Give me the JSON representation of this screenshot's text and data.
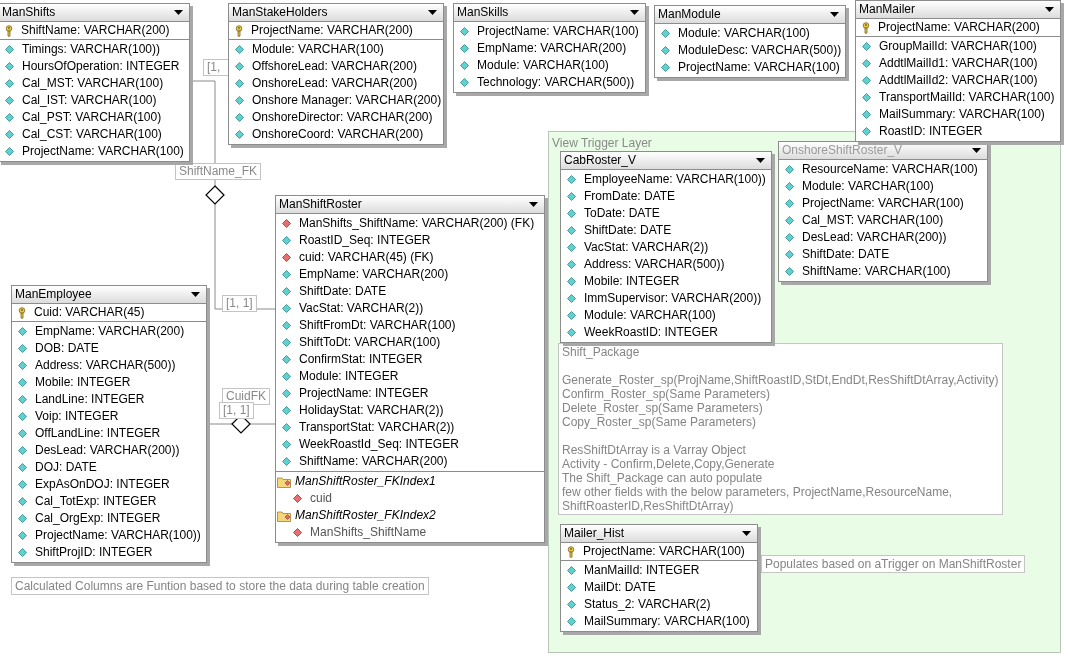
{
  "tables": [
    {
      "name": "ManShifts",
      "dimmed": false,
      "columns": [
        {
          "name": "ShiftName: VARCHAR(200)",
          "kind": "key"
        },
        {
          "name": "Timings: VARCHAR(100))",
          "kind": "attribute"
        },
        {
          "name": "HoursOfOperation: INTEGER",
          "kind": "attribute"
        },
        {
          "name": "Cal_MST: VARCHAR(100)",
          "kind": "attribute"
        },
        {
          "name": "Cal_IST: VARCHAR(100)",
          "kind": "attribute"
        },
        {
          "name": "Cal_PST: VARCHAR(100)",
          "kind": "attribute"
        },
        {
          "name": "Cal_CST: VARCHAR(100)",
          "kind": "attribute"
        },
        {
          "name": "ProjectName: VARCHAR(100)",
          "kind": "attribute"
        }
      ]
    },
    {
      "name": "ManStakeHolders",
      "dimmed": false,
      "columns": [
        {
          "name": "ProjectName: VARCHAR(200)",
          "kind": "key"
        },
        {
          "name": "Module: VARCHAR(100)",
          "kind": "attribute"
        },
        {
          "name": "OffshoreLead: VARCHAR(200)",
          "kind": "attribute"
        },
        {
          "name": "OnshoreLead: VARCHAR(200)",
          "kind": "attribute"
        },
        {
          "name": "Onshore Manager: VARCHAR(200)",
          "kind": "attribute"
        },
        {
          "name": "OnshoreDirector: VARCHAR(200)",
          "kind": "attribute"
        },
        {
          "name": "OnshoreCoord: VARCHAR(200)",
          "kind": "attribute"
        }
      ]
    },
    {
      "name": "ManSkills",
      "dimmed": false,
      "columns": [
        {
          "name": "ProjectName: VARCHAR(100)",
          "kind": "attribute"
        },
        {
          "name": "EmpName: VARCHAR(200)",
          "kind": "attribute"
        },
        {
          "name": "Module: VARCHAR(100)",
          "kind": "attribute"
        },
        {
          "name": "Technology: VARCHAR(500))",
          "kind": "attribute"
        }
      ]
    },
    {
      "name": "ManModule",
      "dimmed": false,
      "columns": [
        {
          "name": "Module: VARCHAR(100)",
          "kind": "attribute"
        },
        {
          "name": "ModuleDesc: VARCHAR(500))",
          "kind": "attribute"
        },
        {
          "name": "ProjectName: VARCHAR(100)",
          "kind": "attribute"
        }
      ]
    },
    {
      "name": "ManMailer",
      "dimmed": false,
      "columns": [
        {
          "name": "ProjectName: VARCHAR(200)",
          "kind": "key"
        },
        {
          "name": "GroupMailId: VARCHAR(100)",
          "kind": "attribute"
        },
        {
          "name": "AddtlMailId1: VARCHAR(100)",
          "kind": "attribute"
        },
        {
          "name": "AddtlMailId2: VARCHAR(100)",
          "kind": "attribute"
        },
        {
          "name": "TransportMailId: VARCHAR(100)",
          "kind": "attribute"
        },
        {
          "name": "MailSummary: VARCHAR(100)",
          "kind": "attribute"
        },
        {
          "name": "RoastID: INTEGER",
          "kind": "attribute"
        }
      ]
    },
    {
      "name": "ManShiftRoster",
      "dimmed": false,
      "columns": [
        {
          "name": "ManShifts_ShiftName: VARCHAR(200) (FK)",
          "kind": "foreign_key"
        },
        {
          "name": "RoastID_Seq: INTEGER",
          "kind": "attribute"
        },
        {
          "name": "cuid: VARCHAR(45) (FK)",
          "kind": "foreign_key"
        },
        {
          "name": "EmpName: VARCHAR(200)",
          "kind": "attribute"
        },
        {
          "name": "ShiftDate: DATE",
          "kind": "attribute"
        },
        {
          "name": "VacStat: VARCHAR(2))",
          "kind": "attribute"
        },
        {
          "name": "ShiftFromDt: VARCHAR(100)",
          "kind": "attribute"
        },
        {
          "name": "ShiftToDt: VARCHAR(100)",
          "kind": "attribute"
        },
        {
          "name": "ConfirmStat: INTEGER",
          "kind": "attribute"
        },
        {
          "name": "Module: INTEGER",
          "kind": "attribute"
        },
        {
          "name": "ProjectName: INTEGER",
          "kind": "attribute"
        },
        {
          "name": "HolidayStat: VARCHAR(2))",
          "kind": "attribute"
        },
        {
          "name": "TransportStat: VARCHAR(2))",
          "kind": "attribute"
        },
        {
          "name": "WeekRoastId_Seq: INTEGER",
          "kind": "attribute"
        },
        {
          "name": "ShiftName: VARCHAR(200)",
          "kind": "attribute"
        }
      ],
      "indexes": [
        {
          "name": "ManShiftRoster_FKIndex1",
          "columns": [
            "cuid"
          ]
        },
        {
          "name": "ManShiftRoster_FKIndex2",
          "columns": [
            "ManShifts_ShiftName"
          ]
        }
      ]
    },
    {
      "name": "ManEmployee",
      "dimmed": false,
      "columns": [
        {
          "name": "Cuid: VARCHAR(45)",
          "kind": "key"
        },
        {
          "name": "EmpName: VARCHAR(200)",
          "kind": "attribute"
        },
        {
          "name": "DOB: DATE",
          "kind": "attribute"
        },
        {
          "name": "Address: VARCHAR(500))",
          "kind": "attribute"
        },
        {
          "name": "Mobile: INTEGER",
          "kind": "attribute"
        },
        {
          "name": "LandLine: INTEGER",
          "kind": "attribute"
        },
        {
          "name": "Voip: INTEGER",
          "kind": "attribute"
        },
        {
          "name": "OffLandLine: INTEGER",
          "kind": "attribute"
        },
        {
          "name": "DesLead: VARCHAR(200))",
          "kind": "attribute"
        },
        {
          "name": "DOJ: DATE",
          "kind": "attribute"
        },
        {
          "name": "ExpAsOnDOJ: INTEGER",
          "kind": "attribute"
        },
        {
          "name": "Cal_TotExp: INTEGER",
          "kind": "attribute"
        },
        {
          "name": "Cal_OrgExp: INTEGER",
          "kind": "attribute"
        },
        {
          "name": "ProjectName: VARCHAR(100))",
          "kind": "attribute"
        },
        {
          "name": "ShiftProjID: INTEGER",
          "kind": "attribute"
        }
      ]
    }
  ],
  "layer": {
    "title": "View Trigger Layer",
    "tables": [
      {
        "name": "CabRoster_V",
        "dimmed": false,
        "columns": [
          {
            "name": "EmployeeName: VARCHAR(100))",
            "kind": "attribute"
          },
          {
            "name": "FromDate: DATE",
            "kind": "attribute"
          },
          {
            "name": "ToDate: DATE",
            "kind": "attribute"
          },
          {
            "name": "ShiftDate: DATE",
            "kind": "attribute"
          },
          {
            "name": "VacStat: VARCHAR(2))",
            "kind": "attribute"
          },
          {
            "name": "Address: VARCHAR(500))",
            "kind": "attribute"
          },
          {
            "name": "Mobile: INTEGER",
            "kind": "attribute"
          },
          {
            "name": "ImmSupervisor: VARCHAR(200))",
            "kind": "attribute"
          },
          {
            "name": "Module: VARCHAR(100)",
            "kind": "attribute"
          },
          {
            "name": "WeekRoastID: INTEGER",
            "kind": "attribute"
          }
        ]
      },
      {
        "name": "OnshoreShiftRoster_V",
        "dimmed": true,
        "columns": [
          {
            "name": "ResourceName: VARCHAR(100)",
            "kind": "attribute"
          },
          {
            "name": "Module: VARCHAR(100)",
            "kind": "attribute"
          },
          {
            "name": "ProjectName: VARCHAR(100)",
            "kind": "attribute"
          },
          {
            "name": "Cal_MST: VARCHAR(100)",
            "kind": "attribute"
          },
          {
            "name": "DesLead: VARCHAR(200))",
            "kind": "attribute"
          },
          {
            "name": "ShiftDate: DATE",
            "kind": "attribute"
          },
          {
            "name": "ShiftName: VARCHAR(100)",
            "kind": "attribute"
          }
        ]
      },
      {
        "name": "Mailer_Hist",
        "dimmed": false,
        "columns": [
          {
            "name": "ProjectName: VARCHAR(100)",
            "kind": "key"
          },
          {
            "name": "ManMailId: INTEGER",
            "kind": "attribute"
          },
          {
            "name": "MailDt: DATE",
            "kind": "attribute"
          },
          {
            "name": "Status_2: VARCHAR(2)",
            "kind": "attribute"
          },
          {
            "name": "MailSummary: VARCHAR(100)",
            "kind": "attribute"
          }
        ]
      }
    ],
    "notes": [
      {
        "paragraphs": [
          [
            "Shift_Package"
          ],
          [
            "Generate_Roster_sp(ProjName,ShiftRoastID,StDt,EndDt,ResShiftDtArray,Activity)",
            "Confirm_Roster_sp(Same Parameters)",
            "Delete_Roster_sp(Same Parameters)",
            "Copy_Roster_sp(Same Parameters)"
          ],
          [
            "ResShiftDtArray is a Varray Object",
            "Activity - Confirm,Delete,Copy,Generate",
            "The Shift_Package can auto populate",
            "few other fields with the below parameters, ProjectName,ResourceName,",
            "ShiftRoasterID,ResShiftDtArray)"
          ]
        ]
      },
      {
        "paragraphs": [
          [
            "Populates based on aTrigger on ManShiftRoster"
          ]
        ]
      }
    ]
  },
  "relationships": [
    {
      "name": "ShiftName_FK",
      "cardinality": "[1, 1]"
    },
    {
      "name": "CuidFK",
      "cardinality": "[1, 1]"
    }
  ],
  "stray_labels": [
    "[1,"
  ],
  "notes": [
    {
      "paragraphs": [
        [
          "Calculated Columns are Funtion based to store the data during table creation"
        ]
      ]
    }
  ]
}
